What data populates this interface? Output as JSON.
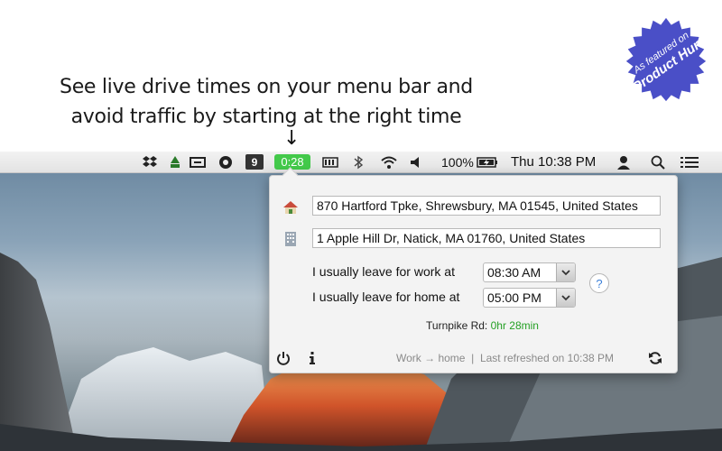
{
  "headline": {
    "line1": "See live drive times on your menu bar and",
    "line2": "avoid traffic by starting at the right time",
    "arrow": "↓"
  },
  "badge": {
    "line1": "As featured on",
    "line2": "Product Hunt",
    "color": "#4a4fc7"
  },
  "menubar": {
    "icons": [
      "dropbox-icon",
      "recycle-icon",
      "grid-icon",
      "circle-a-icon"
    ],
    "badge_number": "9",
    "drive_time": "0:28",
    "battery_percent": "100%",
    "clock": "Thu 10:38 PM",
    "right_icons": [
      "user-icon",
      "search-icon",
      "list-icon"
    ]
  },
  "popover": {
    "home_address": "870 Hartford Tpke, Shrewsbury, MA  01545, United States",
    "work_address": "1 Apple Hill Dr, Natick, MA  01760, United States",
    "leave_work_label": "I usually leave for work at",
    "leave_work_time": "08:30 AM",
    "leave_home_label": "I usually leave for home at",
    "leave_home_time": "05:00 PM",
    "help": "?",
    "route_label": "Turnpike Rd:",
    "route_time": "0hr 28min",
    "direction": "Work → home",
    "separator": "|",
    "refreshed": "Last refreshed on 10:38 PM"
  },
  "colors": {
    "timer_green": "#43c94a",
    "route_green": "#25a025",
    "help_blue": "#3b7fd8"
  }
}
